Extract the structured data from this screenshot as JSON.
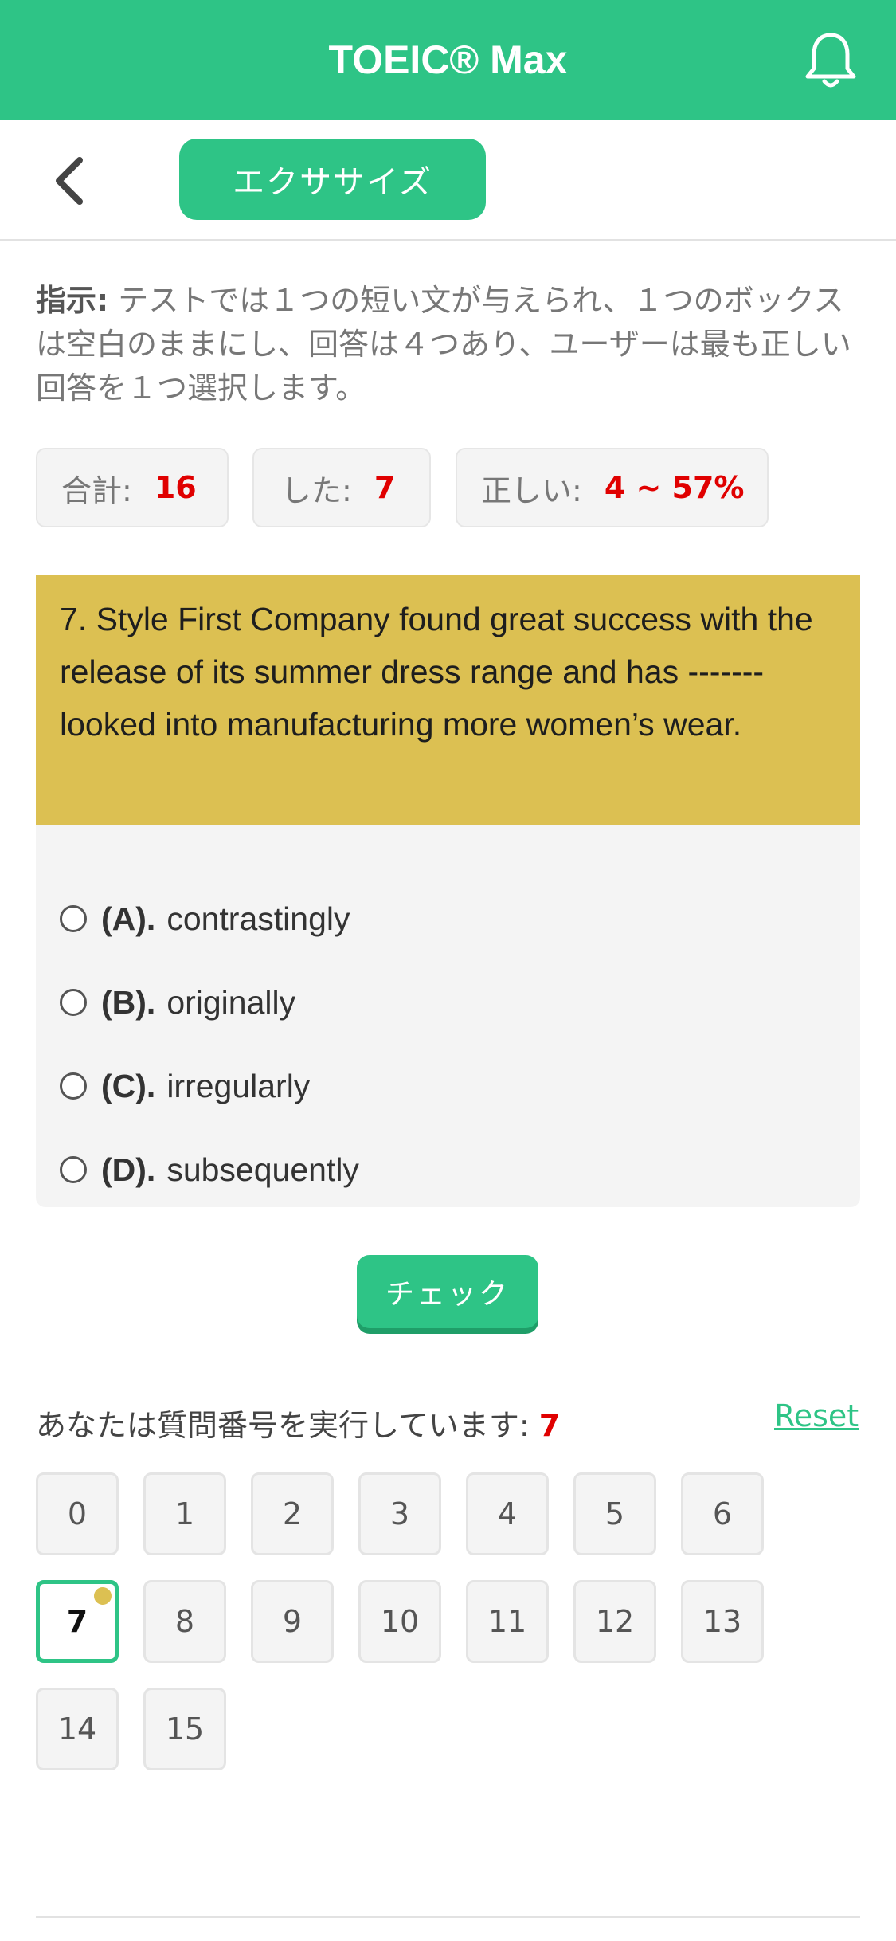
{
  "header": {
    "title": "TOEIC® Max",
    "accent_color": "#2ec486",
    "icons": [
      "bell-icon"
    ]
  },
  "subbar": {
    "back_icon": "chevron-left-icon",
    "tab_label": "エクササイズ"
  },
  "instructions": {
    "label": "指示:",
    "text": " テストでは１つの短い文が与えられ、１つのボックスは空白のままにし、回答は４つあり、ユーザーは最も正しい回答を１つ選択します。"
  },
  "stats": {
    "total_label": "合計:",
    "total_value": "16",
    "done_label": "した:",
    "done_value": "7",
    "correct_label": "正しい:",
    "correct_value": "4 ~ 57%"
  },
  "question": {
    "text": "7. Style First Company found great success with the release of its summer dress range and has ------- looked into manufacturing more women’s wear.",
    "highlight_color": "#dcc052"
  },
  "options": [
    {
      "letter": "(A).",
      "text": "contrastingly"
    },
    {
      "letter": "(B).",
      "text": "originally"
    },
    {
      "letter": "(C).",
      "text": "irregularly"
    },
    {
      "letter": "(D).",
      "text": "subsequently"
    }
  ],
  "check_label": "チェック",
  "navigator": {
    "label": "あなたは質問番号を実行しています:",
    "current": "7",
    "reset_label": "Reset",
    "numbers": [
      "0",
      "1",
      "2",
      "3",
      "4",
      "5",
      "6",
      "7",
      "8",
      "9",
      "10",
      "11",
      "12",
      "13",
      "14",
      "15"
    ]
  }
}
